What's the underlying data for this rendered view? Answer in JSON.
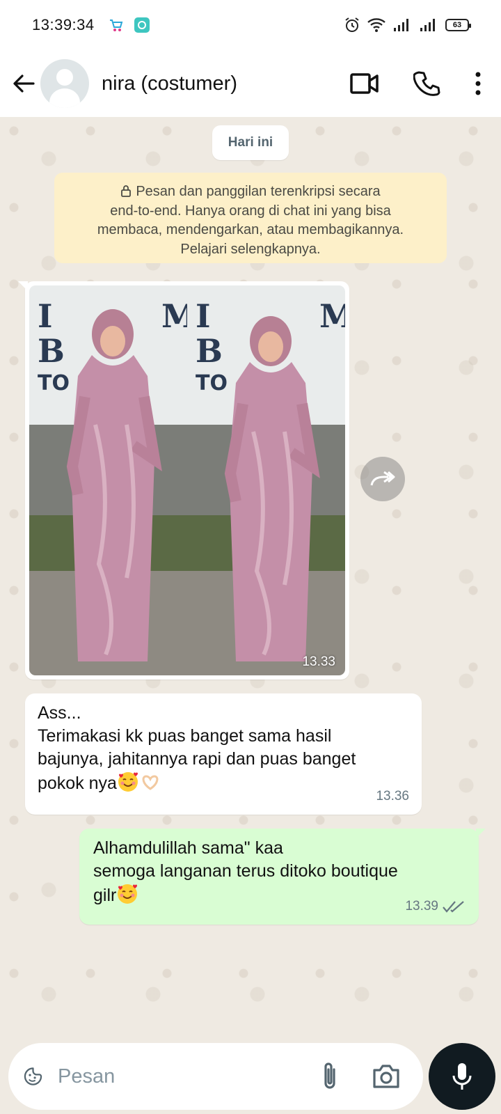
{
  "status_bar": {
    "time": "13:39:34",
    "battery": "63"
  },
  "header": {
    "contact_name": "nira (costumer)"
  },
  "chat": {
    "date_chip": "Hari ini",
    "encryption_notice": {
      "line1": "Pesan dan panggilan terenkripsi secara",
      "line2": "end-to-end. Hanya orang di chat ini yang bisa",
      "line3": "membaca, mendengarkan, atau membagikannya.",
      "line4": "Pelajari selengkapnya."
    },
    "image_message": {
      "time": "13.33"
    },
    "incoming_message": {
      "line1": "Ass...",
      "line2": "Terimakasi kk puas banget sama hasil",
      "line3": "bajunya, jahitannya rapi dan puas banget",
      "line4": "pokok nya",
      "time": "13.36"
    },
    "outgoing_message": {
      "line1": "Alhamdulillah sama\" kaa",
      "line2": "semoga langanan terus ditoko boutique",
      "line3": "gilr",
      "time": "13.39"
    }
  },
  "input": {
    "placeholder": "Pesan"
  },
  "colors": {
    "outgoing_bubble": "#d9fdd3",
    "incoming_bubble": "#ffffff",
    "notice_bg": "#fdf0c9",
    "chat_bg": "#efeae2",
    "mic_button": "#111b21"
  }
}
